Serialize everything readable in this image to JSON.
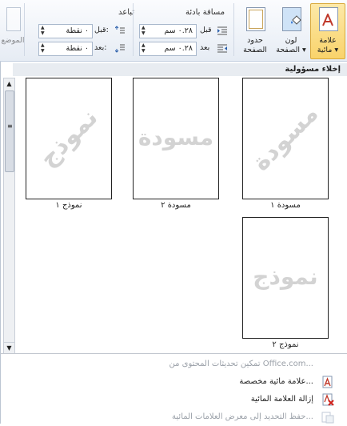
{
  "ribbon": {
    "watermark_label": "علامة\nمائية ▾",
    "page_color_label": "لون\nالصفحة ▾",
    "page_borders_label": "حدود\nالصفحة",
    "indent_group_label": "مسافة بادئة",
    "spacing_group_label": "تباعد",
    "indent_before_label": "قبل",
    "indent_after_label": "بعد",
    "indent_before_value": "٠.٢٨ سم",
    "indent_after_value": "٠.٢٨ سم",
    "spacing_before_label": "قبل:",
    "spacing_after_label": "بعد:",
    "spacing_before_value": "٠ نقطة",
    "spacing_after_value": "٠ نقطة",
    "position_label": "الموضع"
  },
  "gallery": {
    "section_title": "إخلاء مسؤولية",
    "items": [
      {
        "caption": "مسودة ١",
        "watermark": "مسودة"
      },
      {
        "caption": "مسودة ٢",
        "watermark": "مسودة"
      },
      {
        "caption": "نموذج ١",
        "watermark": "نموذج"
      },
      {
        "caption": "نموذج ٢",
        "watermark": "نموذج"
      }
    ]
  },
  "menu": {
    "enable_updates": "تمكين تحديثات المحتوى من Office.com...",
    "custom_watermark": "علامة مائية مخصصة...",
    "remove_watermark": "إزالة العلامة المائية",
    "save_selection": "حفظ التحديد إلى معرض العلامات المائية..."
  },
  "colors": {
    "accent": "#f9d36b",
    "ribbon": "#e6ecf4",
    "disabled": "#9aa0a8"
  }
}
